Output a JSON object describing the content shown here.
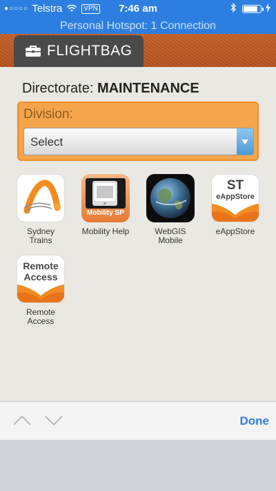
{
  "status_bar": {
    "signal": "●○○○○",
    "carrier": "Telstra",
    "wifi_icon": "wifi-icon",
    "vpn": "VPN",
    "time": "7:46 am",
    "battery_level": 0.85
  },
  "hotspot": {
    "text": "Personal Hotspot: 1 Connection"
  },
  "header": {
    "title": "FLIGHTBAG",
    "background_color": "#b9571f"
  },
  "directorate": {
    "label": "Directorate:",
    "value": "MAINTENANCE"
  },
  "division": {
    "label": "Division:",
    "select_value": "Select"
  },
  "apps": [
    {
      "label": "Sydney Trains",
      "icon": "sydney-trains-logo"
    },
    {
      "label": "Mobility Help",
      "icon": "mobility-help-icon",
      "badge": "Mobility SP"
    },
    {
      "label": "WebGIS Mobile",
      "icon": "globe-icon"
    },
    {
      "label": "eAppStore",
      "icon": "eappstore-icon",
      "line1": "ST",
      "line2": "eAppStore"
    },
    {
      "label": "Remote Access",
      "icon": "remote-access-icon",
      "line1": "Remote",
      "line2": "Access"
    }
  ],
  "accessory": {
    "done": "Done"
  },
  "colors": {
    "accent_blue": "#2c7fe0",
    "orange": "#f28b22",
    "done_blue": "#2f7de0"
  }
}
